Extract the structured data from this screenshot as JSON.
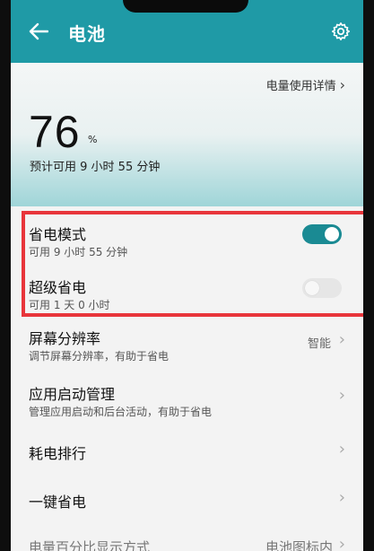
{
  "header": {
    "title": "电池"
  },
  "battery": {
    "detail_link": "电量使用详情",
    "percent": "76",
    "percent_unit": "%",
    "estimate": "预计可用 9 小时 55 分钟"
  },
  "settings": {
    "power_saving": {
      "label": "省电模式",
      "sub": "可用 9 小时 55 分钟",
      "enabled": true
    },
    "super_saving": {
      "label": "超级省电",
      "sub": "可用 1 天 0 小时",
      "enabled": false
    },
    "resolution": {
      "label": "屏幕分辨率",
      "sub": "调节屏幕分辨率，有助于省电",
      "value": "智能"
    },
    "startup": {
      "label": "应用启动管理",
      "sub": "管理应用启动和后台活动，有助于省电"
    },
    "ranking": {
      "label": "耗电排行"
    },
    "one_key": {
      "label": "一键省电"
    },
    "percent_display": {
      "label": "电量百分比显示方式",
      "value": "电池图标内"
    }
  },
  "colors": {
    "accent": "#1f9aa6",
    "highlight": "#e8353b"
  },
  "icons": {
    "back": "back-arrow-icon",
    "settings": "gear-icon",
    "chevron": "chevron-right-icon"
  }
}
